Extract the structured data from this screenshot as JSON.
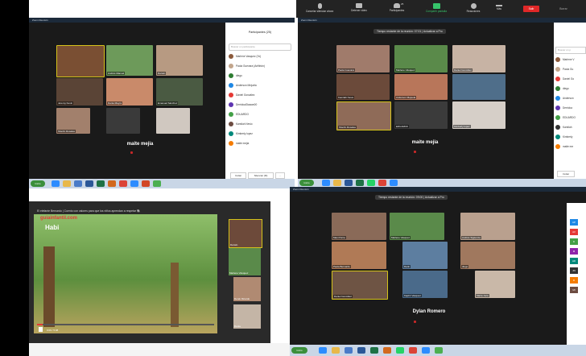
{
  "top_toolbar": {
    "items": [
      "Cancelar silenciar ahora",
      "Detener video",
      "Participantes",
      "Compartir pantalla",
      "Reacciones",
      "Más"
    ],
    "participant_count": "25",
    "end_label": "Salir",
    "extra_label": "Borrar"
  },
  "q1": {
    "title": "Zoom Reunión",
    "big_name": "maite mejia",
    "tile_labels": [
      "",
      "Andrés Manuel",
      "Darwin",
      "Jeremy Kevin",
      "Dania Mayra",
      "Emanuel Sánchez",
      "Sherlin Rosales",
      "",
      "",
      "",
      "",
      ""
    ],
    "participants_panel": {
      "title": "Participantes (25)",
      "search_placeholder": "Buscar un participante",
      "items": [
        "Marlene Vasquez (Yo)",
        "Paola Guevara (Anfitrión)",
        "diego",
        "Anderson Mejuela",
        "Daniel González",
        "DerrickaGlawan00",
        "EDUARDO",
        "Kamilah Nevio",
        "Kimberly lopez",
        "maite mejia"
      ],
      "btn_invite": "Invitar",
      "btn_mute": "Silenciar (M)",
      "btn_more": "…"
    }
  },
  "q2": {
    "title": "Zoom Reunión",
    "notice": "Tiempo restante de la reunión: 07:01 | Actualizar a Pro",
    "big_name": "maite mejia",
    "tile_labels": [
      "Paola Guevara",
      "Marlene Vásquez",
      "Daniel González",
      "Kamilah Nevio",
      "Anderson Mejuela",
      "",
      "Sherlin Rosales",
      "EDUARDO",
      "Kimberly lopez"
    ],
    "sidebar_items": [
      "Marlene V",
      "Paola Gu",
      "Daniel Go",
      "diego",
      "Anderson",
      "Derricka",
      "EDUARDO",
      "Kamilah",
      "Kimberly",
      "maite me"
    ],
    "sidebar_search": "Buscar un p",
    "sidebar_btn": "Invitar"
  },
  "q3": {
    "caption": "El elefante Bernardo | Cuento con valores para que los niños aprendan a respetar 🐘",
    "site": "guiainfantil.com",
    "video_title": "Habi",
    "time": "0:09 / 5:38",
    "mini_names": [
      "Darwin",
      "Marlene Vásquez",
      "Derek Ricardo",
      "Dania"
    ]
  },
  "q4": {
    "title": "Zoom Reunión",
    "notice": "Tiempo restante de la reunión: 09:00 | Actualizar a Pro",
    "big_name": "Dylan Romero",
    "tile_labels": [
      "Mani Parra",
      "Marlene Vasquez",
      "Andrés Sigüenza",
      "Paola Bernardo",
      "Darin",
      "diego",
      "Daniel González",
      "Kaphri Vasquez",
      "Maria Juca",
      "",
      ""
    ],
    "strip_labels": [
      "AP",
      "AV",
      "D",
      "M",
      "HD",
      "JN",
      "R",
      "MI"
    ]
  },
  "taskbar": {
    "start_label": "Inicio",
    "time": "11:35"
  },
  "colors": {
    "zoom_bg": "#1a1a1a",
    "accent": "#2d8cff",
    "end_red": "#e02828",
    "active_border": "#d4c21a"
  }
}
